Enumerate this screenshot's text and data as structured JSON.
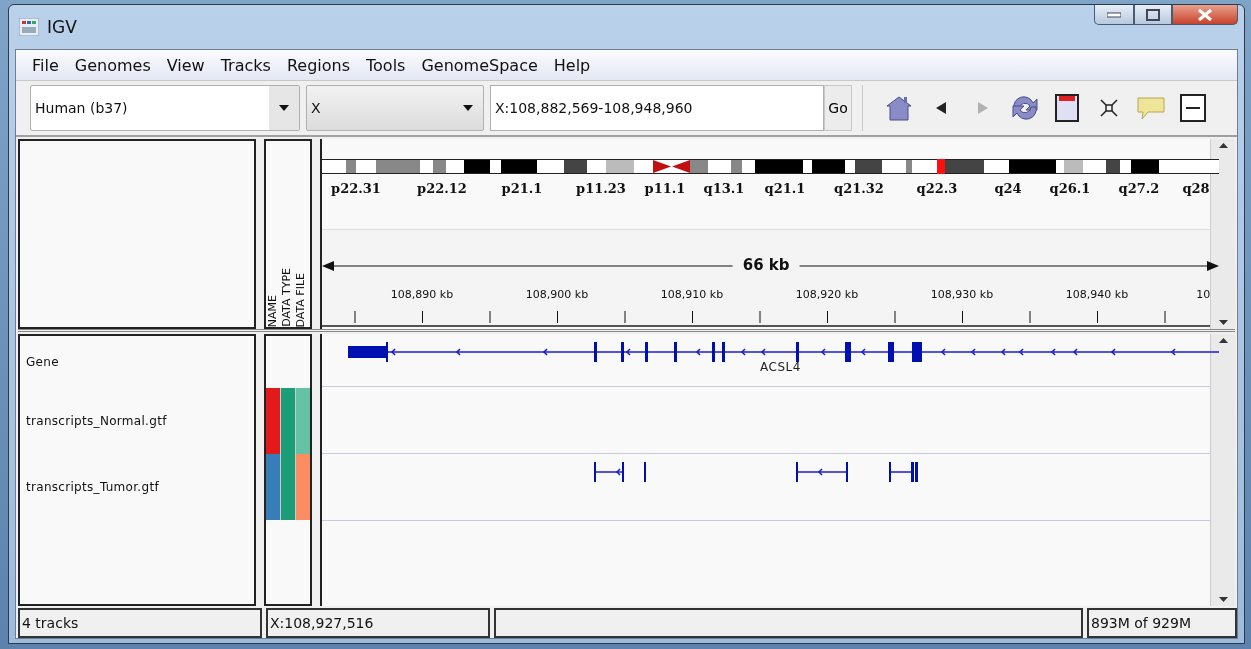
{
  "window": {
    "title": "IGV"
  },
  "menu": [
    {
      "label": "File"
    },
    {
      "label": "Genomes"
    },
    {
      "label": "View"
    },
    {
      "label": "Tracks"
    },
    {
      "label": "Regions"
    },
    {
      "label": "Tools"
    },
    {
      "label": "GenomeSpace"
    },
    {
      "label": "Help"
    }
  ],
  "toolbar": {
    "genome": "Human (b37)",
    "chromosome": "X",
    "locus": "X:108,882,569-108,948,960",
    "go": "Go",
    "buttons": [
      {
        "kind": "home",
        "disabled": false
      },
      {
        "kind": "back",
        "disabled": false
      },
      {
        "kind": "forward",
        "disabled": true
      },
      {
        "kind": "refresh",
        "disabled": false
      },
      {
        "kind": "roi",
        "disabled": false
      },
      {
        "kind": "fit",
        "disabled": false
      },
      {
        "kind": "popup",
        "disabled": false
      },
      {
        "kind": "zoom_out",
        "disabled": false
      }
    ]
  },
  "ideogram": {
    "bands": [
      "p22.31",
      "p22.12",
      "p21.1",
      "p11.23",
      "p11.1",
      "q13.1",
      "q21.1",
      "q21.32",
      "q22.3",
      "q24",
      "q26.1",
      "q27.2",
      "q28"
    ]
  },
  "ruler": {
    "span": "66 kb",
    "ticks": [
      "108,890 kb",
      "108,900 kb",
      "108,910 kb",
      "108,920 kb",
      "108,930 kb",
      "108,940 kb",
      "10"
    ]
  },
  "attribute_headers": [
    "NAME",
    "DATA TYPE",
    "DATA FILE"
  ],
  "tracks": [
    {
      "name": "Gene",
      "kind": "gene",
      "feature_label": "ACSL4"
    },
    {
      "name": "transcripts_Normal.gtf",
      "kind": "transcripts",
      "has_features": false,
      "attributes": [
        {
          "color": "#e31a1c"
        },
        {
          "color": "#1b9e77"
        },
        {
          "color": "#66c2a5"
        }
      ]
    },
    {
      "name": "transcripts_Tumor.gtf",
      "kind": "transcripts",
      "has_features": true,
      "attributes": [
        {
          "color": "#377eb8"
        },
        {
          "color": "#1b9e77"
        },
        {
          "color": "#fc8d62"
        }
      ]
    }
  ],
  "status_bar": {
    "tracks": "4 tracks",
    "position": "X:108,927,516",
    "memory": "893M of 929M"
  }
}
